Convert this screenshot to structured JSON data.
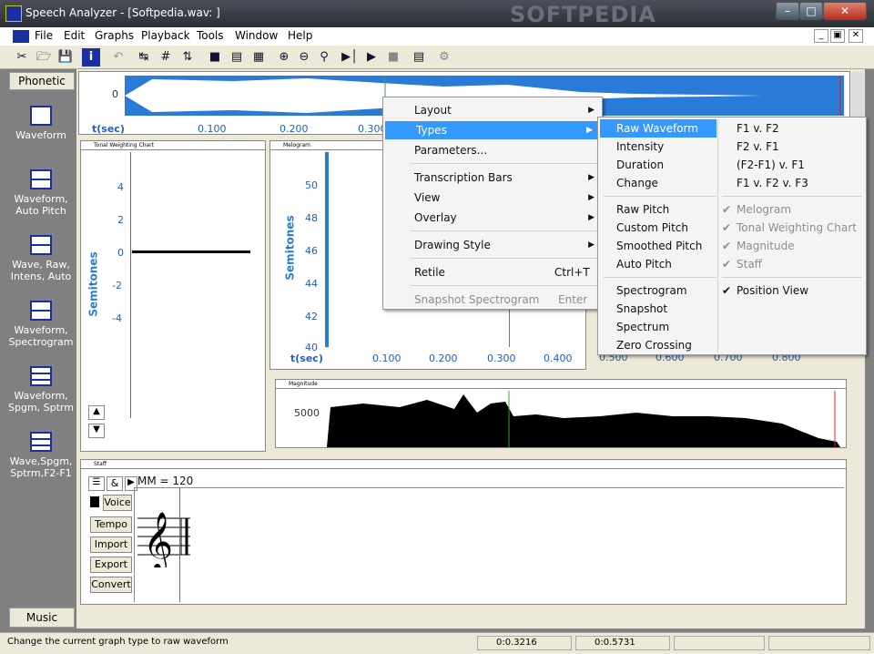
{
  "window": {
    "title": "Speech Analyzer - [Softpedia.wav: ]",
    "watermark": "SOFTPEDIA"
  },
  "menu": [
    "File",
    "Edit",
    "Graphs",
    "Playback",
    "Tools",
    "Window",
    "Help"
  ],
  "sidebar": {
    "tab": "Phonetic",
    "items": [
      {
        "label": "Waveform"
      },
      {
        "label": "Waveform, Auto Pitch"
      },
      {
        "label": "Wave, Raw, Intens, Auto"
      },
      {
        "label": "Waveform, Spectrogram"
      },
      {
        "label": "Waveform, Spgm, Sptrm"
      },
      {
        "label": "Wave,Spgm, Sptrm,F2-F1"
      }
    ],
    "bottom_tab": "Music"
  },
  "waveform": {
    "y_tick": "0",
    "x_label": "t(sec)",
    "x_ticks": [
      "0.100",
      "0.200",
      "0.300"
    ]
  },
  "tonal_chart": {
    "title": "Tonal Weighting Chart",
    "ylabel": "Semitones",
    "ticks": [
      "4",
      "2",
      "0",
      "-2",
      "-4"
    ]
  },
  "melogram": {
    "title": "Melogram",
    "ylabel": "Semitones",
    "ticks": [
      "50",
      "48",
      "46",
      "44",
      "42",
      "40"
    ],
    "x_label": "t(sec)",
    "x_ticks": [
      "0.100",
      "0.200",
      "0.300",
      "0.400",
      "0.500",
      "0.600",
      "0.700",
      "0.800"
    ]
  },
  "magnitude": {
    "title": "Magnitude",
    "tick": "5000"
  },
  "staff": {
    "title": "Staff",
    "tempo_text": "MM = 120",
    "voice": "Voice",
    "buttons": [
      "Tempo",
      "Import",
      "Export",
      "Convert"
    ]
  },
  "context_menu": [
    {
      "label": "Layout",
      "sub": true
    },
    {
      "label": "Types",
      "sub": true,
      "highlight": true
    },
    {
      "label": "Parameters..."
    },
    {
      "label": "Transcription Bars",
      "sub": true
    },
    {
      "label": "View",
      "sub": true
    },
    {
      "label": "Overlay",
      "sub": true
    },
    {
      "label": "Drawing Style",
      "sub": true
    },
    {
      "label": "Retile",
      "shortcut": "Ctrl+T"
    },
    {
      "label": "Snapshot Spectrogram",
      "shortcut": "Enter",
      "disabled": true
    }
  ],
  "types_menu": {
    "col1": [
      "Raw Waveform",
      "Intensity",
      "Duration",
      "Change",
      "Raw Pitch",
      "Custom Pitch",
      "Smoothed Pitch",
      "Auto Pitch",
      "Spectrogram",
      "Snapshot",
      "Spectrum",
      "Zero Crossing"
    ],
    "col2": [
      "F1 v. F2",
      "F2 v. F1",
      "(F2-F1) v. F1",
      "F1 v. F2 v. F3",
      "Melogram",
      "Tonal Weighting Chart",
      "Magnitude",
      "Staff",
      "Position View"
    ]
  },
  "status": {
    "text": "Change the current graph type to raw waveform",
    "pos1": "0:0.3216",
    "pos2": "0:0.5731"
  }
}
